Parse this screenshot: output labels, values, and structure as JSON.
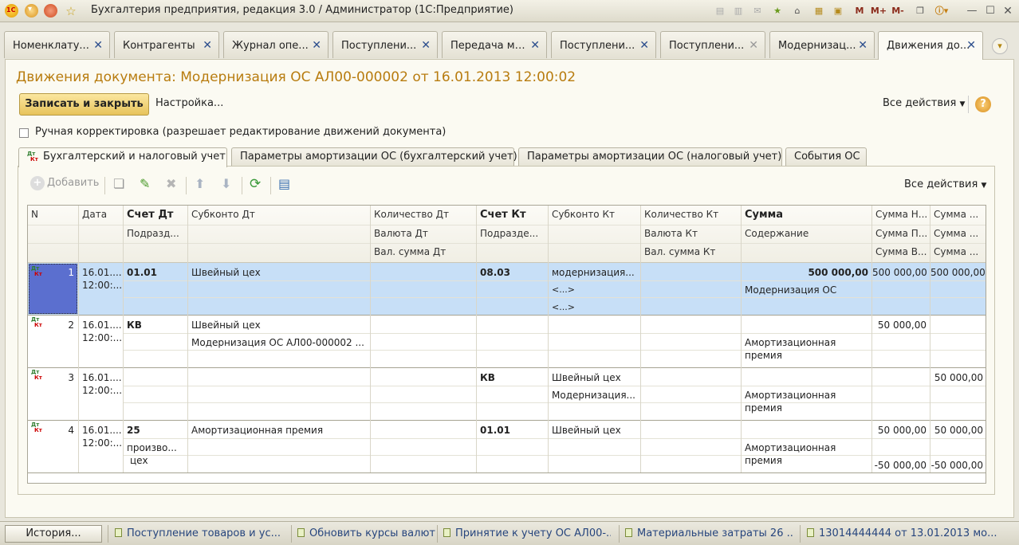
{
  "window": {
    "title": "Бухгалтерия предприятия, редакция 3.0 / Администратор  (1С:Предприятие)",
    "tb_buttons": [
      "M",
      "M+",
      "M-"
    ]
  },
  "tabs": [
    {
      "label": "Номенклату..."
    },
    {
      "label": "Контрагенты"
    },
    {
      "label": "Журнал опе..."
    },
    {
      "label": "Поступлени..."
    },
    {
      "label": "Передача ма..."
    },
    {
      "label": "Поступлени..."
    },
    {
      "label": "Поступлени..."
    },
    {
      "label": "Модернизац..."
    },
    {
      "label": "Движения до..."
    }
  ],
  "form": {
    "title": "Движения документа: Модернизация ОС АЛ00-000002 от 16.01.2013 12:00:02",
    "save_close": "Записать и закрыть",
    "settings": "Настройка...",
    "all_actions": "Все действия",
    "help": "?",
    "manual_edit": "Ручная корректировка (разрешает редактирование движений документа)"
  },
  "ptabs": [
    {
      "label": "Бухгалтерский и налоговый учет"
    },
    {
      "label": "Параметры амортизации ОС (бухгалтерский учет)"
    },
    {
      "label": "Параметры амортизации ОС (налоговый учет)"
    },
    {
      "label": "События ОС"
    }
  ],
  "toolbar": {
    "add": "Добавить",
    "all_actions": "Все действия"
  },
  "grid": {
    "headers_row1": [
      "N",
      "Дата",
      "Счет Дт",
      "Субконто Дт",
      "Количество Дт",
      "Счет Кт",
      "Субконто Кт",
      "Количество Кт",
      "Сумма",
      "Сумма Н...",
      "Сумма ..."
    ],
    "headers_row2": [
      "Подразд...",
      "Валюта Дт",
      "Подразде...",
      "Валюта Кт",
      "Содержание",
      "Сумма П...",
      "Сумма ..."
    ],
    "headers_row3": [
      "Вал. сумма Дт",
      "Вал. сумма Кт",
      "Сумма В...",
      "Сумма ..."
    ],
    "dt": "Дт",
    "kt": "Кт",
    "rows": [
      {
        "n": "1",
        "date1": "16.01....",
        "date2": "12:00:...",
        "schet_dt": "01.01",
        "sub_dt": "Швейный цех",
        "schet_kt": "08.03",
        "sub_kt1": "модернизация...",
        "sub_kt2": "<...>",
        "sub_kt3": "<...>",
        "summa": "500 000,00",
        "content": "Модернизация ОС",
        "sum_n": "500 000,00",
        "sum_x": "500 000,00"
      },
      {
        "n": "2",
        "date1": "16.01....",
        "date2": "12:00:...",
        "schet_dt": "КВ",
        "sub_dt1": "Швейный цех",
        "sub_dt2": "Модернизация ОС АЛ00-000002 ...",
        "content1": "Амортизационная",
        "content2": "премия",
        "sum_n": "50 000,00"
      },
      {
        "n": "3",
        "date1": "16.01....",
        "date2": "12:00:...",
        "schet_kt": "КВ",
        "sub_kt1": "Швейный цех",
        "sub_kt2": "Модернизация...",
        "content1": "Амортизационная",
        "content2": "премия",
        "sum_x": "50 000,00"
      },
      {
        "n": "4",
        "date1": "16.01....",
        "date2": "12:00:...",
        "schet_dt": "25",
        "podr1": "произво...",
        "podr2": "цех",
        "sub_dt": "Амортизационная премия",
        "schet_kt": "01.01",
        "sub_kt": "Швейный цех",
        "content1": "Амортизационная",
        "content2": "премия",
        "sum_n1": "50 000,00",
        "sum_x1": "50 000,00",
        "sum_n3": "-50 000,00",
        "sum_x3": "-50 000,00"
      }
    ]
  },
  "statusbar": {
    "history": "История...",
    "items": [
      "Поступление товаров и ус...",
      "Обновить курсы валют",
      "Принятие к учету ОС АЛ00-...",
      "Материальные затраты 26 ...",
      "13014444444 от 13.01.2013 мо..."
    ]
  }
}
